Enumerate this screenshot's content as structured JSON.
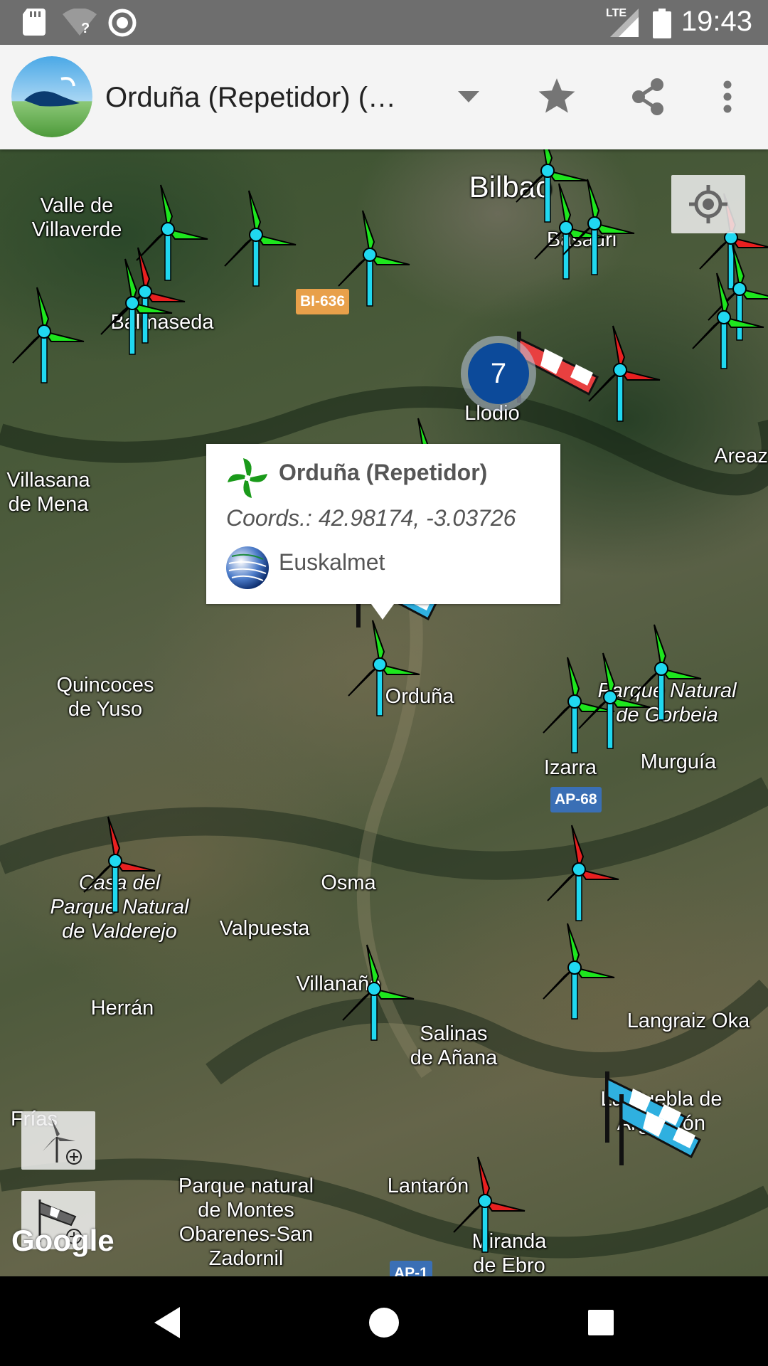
{
  "status_bar": {
    "time": "19:43",
    "network": "LTE",
    "icons": [
      "sd-card-icon",
      "wifi-unknown-icon",
      "sync-icon",
      "signal-icon",
      "battery-icon"
    ]
  },
  "app_bar": {
    "title": "Orduña (Repetidor) (…",
    "actions": [
      "dropdown-icon",
      "star-icon",
      "share-icon",
      "more-vert-icon"
    ]
  },
  "map": {
    "cluster_count": "7",
    "labels": [
      {
        "id": "valle",
        "text": "Valle de\nVillaverde",
        "italic": false
      },
      {
        "id": "balmaseda",
        "text": "Balmaseda",
        "italic": false
      },
      {
        "id": "bilbao",
        "text": "Bilbao",
        "italic": false
      },
      {
        "id": "basauri",
        "text": "Basauri",
        "italic": false
      },
      {
        "id": "llodio",
        "text": "Llodio",
        "italic": false
      },
      {
        "id": "areaza",
        "text": "Areaz",
        "italic": false
      },
      {
        "id": "villasana",
        "text": "Villasana\nde Mena",
        "italic": false
      },
      {
        "id": "quincoces",
        "text": "Quincoces\nde Yuso",
        "italic": false
      },
      {
        "id": "orduna",
        "text": "Orduña",
        "italic": false
      },
      {
        "id": "gorbeia",
        "text": "Parque Natural\nde Gorbeia",
        "italic": true
      },
      {
        "id": "izarra",
        "text": "Izarra",
        "italic": false
      },
      {
        "id": "murguia",
        "text": "Murguía",
        "italic": false
      },
      {
        "id": "valderejo",
        "text": "Casa del\nParque Natural\nde Valderejo",
        "italic": true
      },
      {
        "id": "osma",
        "text": "Osma",
        "italic": false
      },
      {
        "id": "valpuesta",
        "text": "Valpuesta",
        "italic": false
      },
      {
        "id": "villanane",
        "text": "Villanañe",
        "italic": false
      },
      {
        "id": "herran",
        "text": "Herrán",
        "italic": false
      },
      {
        "id": "salinas",
        "text": "Salinas\nde Añana",
        "italic": false
      },
      {
        "id": "langraiz",
        "text": "Langraiz Oka",
        "italic": false
      },
      {
        "id": "puebla",
        "text": "La Puebla de\nArganzón",
        "italic": false
      },
      {
        "id": "frias",
        "text": "Frías",
        "italic": false
      },
      {
        "id": "montes",
        "text": "Parque natural\nde Montes\nObarenes-San\nZadornil",
        "italic": false
      },
      {
        "id": "lantaron",
        "text": "Lantarón",
        "italic": false
      },
      {
        "id": "miranda",
        "text": "Miranda\nde Ebro",
        "italic": false
      }
    ],
    "roads": [
      {
        "id": "bi636",
        "text": "BI-636",
        "color": "#e8a04a"
      },
      {
        "id": "ap68",
        "text": "AP-68",
        "color": "#3a6fb5"
      },
      {
        "id": "ap1",
        "text": "AP-1",
        "color": "#3a6fb5"
      }
    ],
    "google_label": "Google"
  },
  "info_window": {
    "title": "Orduña (Repetidor)",
    "coords": "Coords.: 42.98174, -3.03726",
    "provider": "Euskalmet"
  },
  "colors": {
    "turbine_green": "#1ee61e",
    "turbine_red": "#e82020",
    "turbine_pole": "#20d8f0",
    "cluster_blue": "#0c4a9a"
  }
}
